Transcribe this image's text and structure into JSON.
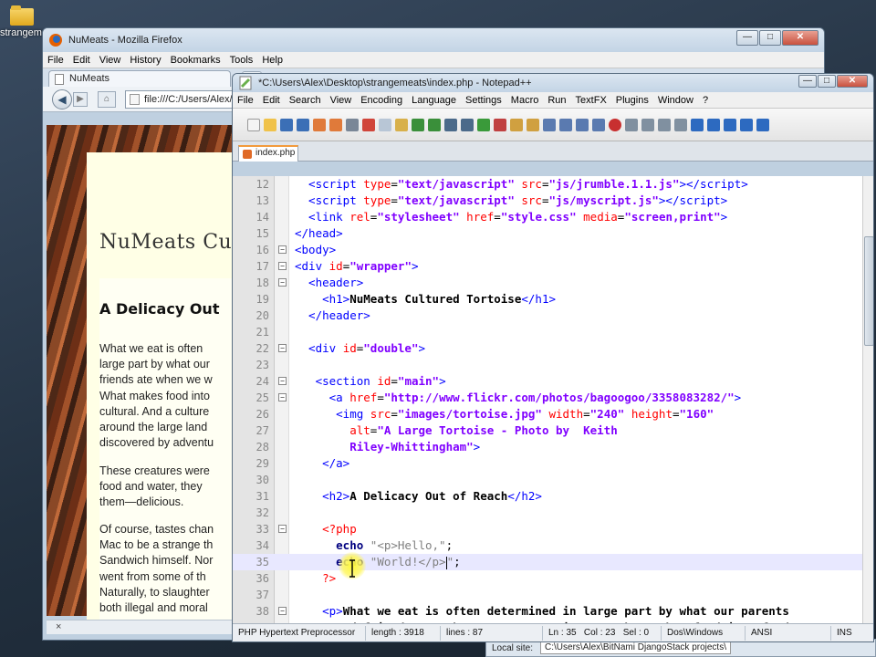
{
  "desktop": {
    "icon_label": "strangeme"
  },
  "firefox": {
    "title": "NuMeats - Mozilla Firefox",
    "menu": [
      "File",
      "Edit",
      "View",
      "History",
      "Bookmarks",
      "Tools",
      "Help"
    ],
    "tab_title": "NuMeats",
    "new_tab": "+",
    "url": "file:///C:/Users/Alex/",
    "page": {
      "h1": "NuMeats Cu",
      "h2": "A Delicacy Out",
      "para1": [
        "What we eat is often",
        "large part by what our",
        "friends ate when we w",
        "What makes food into",
        "cultural. And a culture",
        "around the large land",
        "discovered by adventu"
      ],
      "para2": [
        "These creatures were",
        "food and water, they",
        "them—delicious."
      ],
      "para3": [
        "Of course, tastes chan",
        "Mac to be a strange th",
        "Sandwich himself. Nor",
        "went from some of th",
        "Naturally, to slaughter",
        "both illegal and moral"
      ]
    },
    "status": "×"
  },
  "explorer": {
    "label": "Local site:",
    "path": "C:\\Users\\Alex\\BitNami DjangoStack projects\\"
  },
  "notepad": {
    "title": "*C:\\Users\\Alex\\Desktop\\strangemeats\\index.php - Notepad++",
    "menu": [
      "File",
      "Edit",
      "Search",
      "View",
      "Encoding",
      "Language",
      "Settings",
      "Macro",
      "Run",
      "TextFX",
      "Plugins",
      "Window",
      "?"
    ],
    "file_tab": "index.php",
    "line_numbers": [
      "12",
      "13",
      "14",
      "15",
      "16",
      "17",
      "18",
      "19",
      "20",
      "21",
      "22",
      "23",
      "24",
      "25",
      "26",
      "27",
      "28",
      "29",
      "30",
      "31",
      "32",
      "33",
      "34",
      "35",
      "36",
      "37",
      "38",
      "39"
    ],
    "fold_markers": {
      "16": "−",
      "17": "−",
      "18": "−",
      "22": "−",
      "24": "−",
      "25": "−",
      "33": "−",
      "38": "−"
    },
    "status": {
      "filetype": "PHP Hypertext Preprocessor",
      "length": "length : 3918",
      "lines": "lines : 87",
      "position": "Ln : 35   Col : 23   Sel : 0",
      "eol": "Dos\\Windows",
      "encoding": "ANSI",
      "mode": "INS"
    }
  },
  "colors": {
    "tag": "#0000ff",
    "attr": "#ff0000",
    "value": "#8000ff",
    "php": "#ff0000",
    "keyword": "#000080",
    "string": "#808080",
    "current_line": "#e8e8ff"
  }
}
